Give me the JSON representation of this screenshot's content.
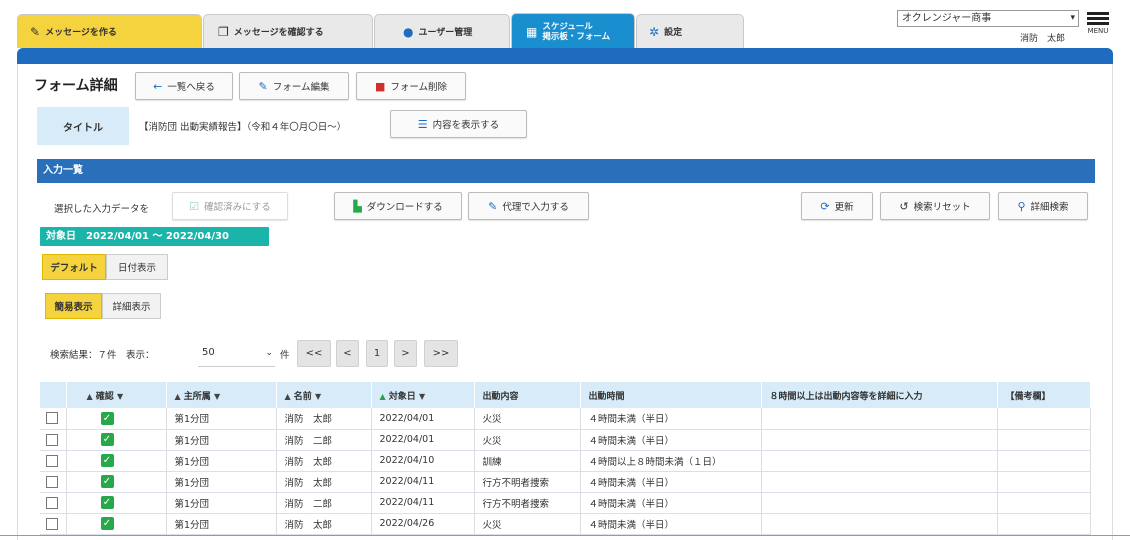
{
  "nav": {
    "tabs": [
      {
        "label": "メッセージを作る",
        "icon": "pencil-icon"
      },
      {
        "label": "メッセージを確認する",
        "icon": "copy-icon"
      },
      {
        "label": "ユーザー管理",
        "icon": "user-icon"
      },
      {
        "label_line1": "スケジュール",
        "label_line2": "掲示板・フォーム",
        "icon": "calendar-icon"
      },
      {
        "label": "設定",
        "icon": "gear-icon"
      }
    ],
    "org_select": "オクレンジャー商事",
    "user_name": "消防　太郎",
    "menu_label": "MENU"
  },
  "page": {
    "title": "フォーム詳細",
    "back_label": "一覧へ戻る",
    "edit_label": "フォーム編集",
    "delete_label": "フォーム削除",
    "title_label": "タイトル",
    "title_value": "【消防団 出動実績報告】（令和４年〇月〇日～）",
    "show_content_label": "内容を表示する"
  },
  "list": {
    "header": "入力一覧",
    "selected_label": "選択した入力データを",
    "confirmed_label": "確認済みにする",
    "download_label": "ダウンロードする",
    "proxy_label": "代理で入力する",
    "refresh_label": "更新",
    "reset_label": "検索リセット",
    "search_label": "詳細検索",
    "date_range": "対象日　2022/04/01 ～ 2022/04/30",
    "seg_default": "デフォルト",
    "seg_date": "日付表示",
    "seg_simple": "簡易表示",
    "seg_detail": "詳細表示",
    "results": "検索結果：７件　表示：",
    "per_page": "50",
    "per_unit": "件",
    "pager": {
      "first": "<<",
      "prev": "<",
      "page": "1",
      "next": ">",
      "last": ">>"
    }
  },
  "table": {
    "headers": {
      "confirm": "確認",
      "affiliation": "主所属",
      "name": "名前",
      "date": "対象日",
      "content": "出動内容",
      "time": "出動時間",
      "note8": "８時間以上は出動内容等を詳細に入力",
      "remarks": "【備考欄】"
    },
    "rows": [
      {
        "affiliation": "第1分団",
        "name": "消防　太郎",
        "date": "2022/04/01",
        "content": "火災",
        "time": "４時間未満（半日）"
      },
      {
        "affiliation": "第1分団",
        "name": "消防　二郎",
        "date": "2022/04/01",
        "content": "火災",
        "time": "４時間未満（半日）"
      },
      {
        "affiliation": "第1分団",
        "name": "消防　太郎",
        "date": "2022/04/10",
        "content": "訓練",
        "time": "４時間以上８時間未満（１日）"
      },
      {
        "affiliation": "第1分団",
        "name": "消防　太郎",
        "date": "2022/04/11",
        "content": "行方不明者捜索",
        "time": "４時間未満（半日）"
      },
      {
        "affiliation": "第1分団",
        "name": "消防　二郎",
        "date": "2022/04/11",
        "content": "行方不明者捜索",
        "time": "４時間未満（半日）"
      },
      {
        "affiliation": "第1分団",
        "name": "消防　太郎",
        "date": "2022/04/26",
        "content": "火災",
        "time": "４時間未満（半日）"
      }
    ]
  }
}
